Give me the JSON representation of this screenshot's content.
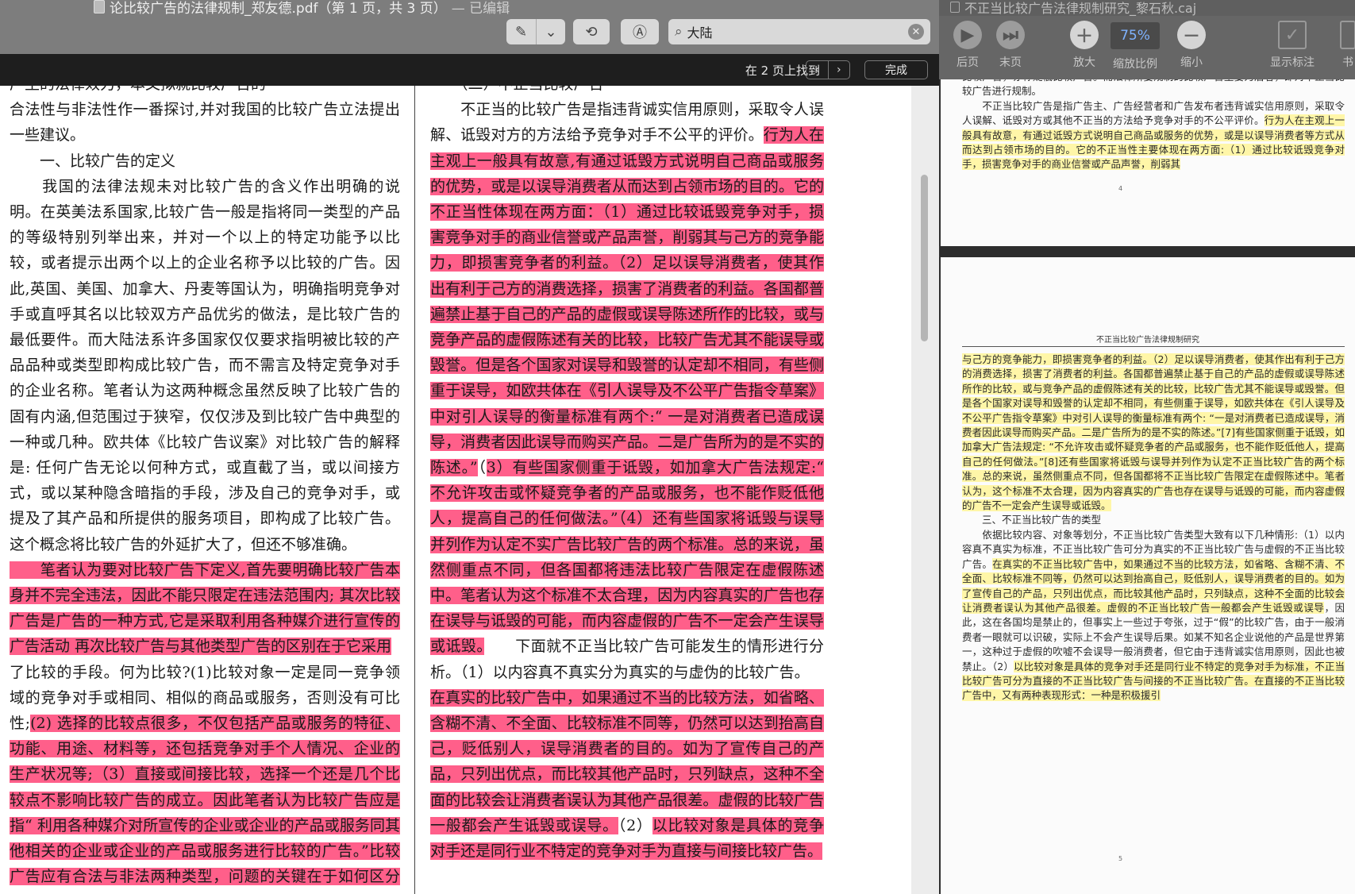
{
  "left": {
    "title": "论比较广告的法律规制_郑友德.pdf（第 1 页，共 3 页）",
    "title_status": "— 已编辑",
    "search_value": "大陆",
    "find_status": "在 2 页上找到",
    "done_label": "完成",
    "col1": [
      {
        "type": "plain",
        "text": "产生的法律效力，本文拟就比较广告的"
      },
      {
        "type": "plain",
        "text": "合法性与非法性作一番探讨,并对我国的比较广告立法提出一些建议。"
      },
      {
        "type": "plain",
        "text": "　　一、比较广告的定义"
      },
      {
        "type": "plain",
        "text": "　　我国的法律法规未对比较广告的含义作出明确的说明。在英美法系国家,比较广告一般是指将同一类型的产品的等级特别列举出来，并对一个以上的特定功能予以比较，或者提示出两个以上的企业名称予以比较的广告。因此,英国、美国、加拿大、丹麦等国认为，明确指明竞争对手或直呼其名以比较双方产品优劣的做法，是比较广告的最低要件。而大陆法系许多国家仅仅要求指明被比较的产品品种或类型即构成比较广告，而不需言及特定竞争对手的企业名称。笔者认为这两种概念虽然反映了比较广告的固有内涵,但范围过于狭窄，仅仅涉及到比较广告中典型的一种或几种。欧共体《比较广告议案》对比较广告的解释是: 任何广告无论以何种方式，或直截了当，或以间接方式，或以某种隐含暗指的手段，涉及自己的竞争对手，或提及了其产品和所提供的服务项目，即构成了比较广告。这个概念将比较广告的外延扩大了，但还不够准确。"
      },
      {
        "type": "highlight",
        "text": "　　笔者认为要对比较广告下定义,首先要明确比较广告本身并不完全违法，因此不能只限定在违法范围内; 其次比较广告是广告的一种方式,它是采取利用各种媒介进行宣传的广告活动 再次比较广告与其他类型广告的区别在于它采用"
      },
      {
        "type": "plain",
        "text": "了比较的手段。何为比较?(1)比较对象一定是同一竞争领域的竞争对手或相同、相似的商品或服务，否则没有可比性;"
      },
      {
        "type": "highlight",
        "text": "(2) 选择的比较点很多，不仅包括产品或服务的特征、功能、用途、材料等，还包括竞争对手个人情况、企业的生产状况等;（3）直接或间接比较，选择一个还是几个比较点不影响比较广告的成立。因此笔者认为比较广告应是指“ 利用各种媒介对所宣传的企业或企业的产品或服务同其他相关的企业或企业的产品或服务进行比较的广告。”比较广告应有合法与非法两种类型，问题的关键在于如何区分非法与合法。"
      }
    ],
    "col2": [
      {
        "type": "plain",
        "text": "　　（二）不正当比较广告"
      },
      {
        "type": "plain",
        "text": "　　不正当的比较广告是指违背诚实信用原则，采取令人误解、诋毁对方的方法给予竞争对手不公平的评价。"
      },
      {
        "type": "highlight",
        "text": "行为人在主观上一般具有故意,有通过诋毁方式说明自己商品或服务的优势，或是以误导消费者从而达到占领市场的目的。它的不正当性体现在两方面：（1）通过比较诋毁竞争对手，损害竞争对手的商业信誉或产品声誉，削弱其与己方的竞争能力，即损害竞争者的利益。（2）足以误导消费者，使其作出有利于己方的消费选择，损害了消费者的利益。各国都普遍禁止基于自己的产品的虚假或误导陈述所作的比较，或与竞争产品的虚假陈述有关的比较，比较广告尤其不能误导或毁誉。但是各个国家对误导和毁誉的认定却不相同，有些侧重于误导，如欧共体在《引人误导及不公平广告指令草案》中对引人误导的衡量标准有两个:“ 一是对消费者已造成误导，消费者因此误导而购买产品。二是广告所为的是不实的陈述。”"
      },
      {
        "type": "plain",
        "text": "（"
      },
      {
        "type": "highlight",
        "text": "3）有些国家侧重于诋毁，如加拿大广告法规定:“ 不允许攻击或怀疑竞争者的产品或服务，也不能作贬低他人，提高自己的任何做法。”（4）还有些国家将诋毁与误导并列作为认定不实广告比较广告的两个标准。总的来说，虽然侧重点不同，但各国都将违法比较广告限定在虚假陈述中。笔者认为这个标准不太合理，因为内容真实的广告也存在误导与诋毁的可能，而内容虚假的广告不一定会产生误导或诋毁。"
      },
      {
        "type": "plain",
        "text": "　　下面就不正当比较广告可能发生的情形进行分析。（1）以内容真不真实分为真实的与虚伪的比较广告。"
      },
      {
        "type": "highlight",
        "text": "在真实的比较广告中，如果通过不当的比较方法，如省略、含糊不清、不全面、比较标准不同等，仍然可以达到抬高自己，贬低别人，误导消费者的目的。如为了宣传自己的产品，只列出优点，而比较其他产品时，只列缺点，这种不全面的比较会让消费者误认为其他产品很差。虚假的比较广告一般都会产生诋毁或误导。"
      },
      {
        "type": "plain",
        "text": "（2）"
      },
      {
        "type": "highlight",
        "text": "以比较对象是具体的竞争对手还是同行业不特定的竞争对手为直接与间接比较广告。"
      }
    ]
  },
  "right": {
    "title": "不正当比较广告法律规制研究_黎石秋.caj",
    "toolbar": {
      "prev_page": "后页",
      "last_page": "末页",
      "zoom_in": "放大",
      "zoom_ratio_label": "缩放比例",
      "zoom_value": "75%",
      "zoom_out": "缩小",
      "show_annot": "显示标注",
      "more": "书"
    },
    "page4_number": "4",
    "page4": [
      {
        "type": "plain",
        "text": "比较广告，亦称贬低比较广告。而法律所要规制的比较广告主要为后者，即对不正当比较广告进行规制。"
      },
      {
        "type": "plain",
        "text": "　　不正当比较广告是指广告主、广告经营者和广告发布者违背诚实信用原则，采取令人误解、诋毁对方或其他不正当的方法给予竞争对手的不公平评价。"
      },
      {
        "type": "highlight",
        "text": "行为人在主观上一般具有故意，有通过诋毁方式说明自己商品或服务的优势，或是以误导消费者等方式从而达到占领市场的目的。它的不正当性主要体现在两方面:（1）通过比较诋毁竞争对手，损害竞争对手的商业信誉或产品声誉，削弱其"
      }
    ],
    "page5_header": "不正当比较广告法律规制研究",
    "page5_number": "5",
    "page5": [
      {
        "type": "highlight",
        "text": "与己方的竞争能力，即损害竞争者的利益。（2）足以误导消费者，使其作出有利于己方的消费选择，损害了消费者的利益。各国都普遍禁止基于自己的产品的虚假或误导陈述所作的比较，或与竞争产品的虚假陈述有关的比较，比较广告尤其不能误导或毁誉。但是各个国家对误导和毁誉的认定却不相同，有些侧重于误导，如欧共体在《引人误导及不公平广告指令草案》中对引人误导的衡量标准有两个: “一是对消费者已造成误导，消费者因此误导而购买产品。二是广告所为的是不实的陈述。”[7]有些国家侧重于诋毁，如加拿大广告法规定: “不允许攻击或怀疑竞争者的产品或服务，也不能作贬低他人，提高自己的任何做法。”[8]还有些国家将诋毁与误导并列作为认定不正当比较广告的两个标准。总的来说，虽然侧重点不同，但各国都将不正当比较广告限定在虚假陈述中。笔者认为，这个标准不太合理，因为内容真实的广告也存在误导与诋毁的可能，而内容虚假的广告不一定会产生误导或诋毁。"
      },
      {
        "type": "plain",
        "text": "　　三、不正当比较广告的类型"
      },
      {
        "type": "plain",
        "text": "　　依据比较内容、对象等划分，不正当比较广告类型大致有以下几种情形:（1）以内容真不真实为标准，不正当比较广告可分为真实的不正当比较广告与虚假的不正当比较广告。"
      },
      {
        "type": "highlight",
        "text": "在真实的不正当比较广告中，如果通过不当的比较方法，如省略、含糊不清、不全面、比较标准不同等，仍然可以达到抬高自己，贬低别人，误导消费者的目的。如为了宣传自己的产品，只列出优点，而比较其他产品时，只列缺点，这种不全面的比较会让消费者误认为其他产品很差。虚假的不正当比较广告一般都会产生诋毁或误导"
      },
      {
        "type": "plain",
        "text": "，因此，这在各国均是禁止的，但事实上一些过于夸张，过于“假”的比较广告，由于一般消费者一眼就可以识破，实际上不会产生误导后果。如某不知名企业说他的产品是世界第一，这种过于虚假的吹嘘不会误导一般消费者，但它由于违背诚实信用原则，因此也被禁止。（2）"
      },
      {
        "type": "highlight",
        "text": "以比较对象是具体的竞争对手还是同行业不特定的竞争对手为标准，不正当比较广告可分为直接的不正当比较广告与间接的不正当比较广告。在直接的不正当比较广告中，又有两种表现形式：一种是积极援引"
      }
    ]
  }
}
